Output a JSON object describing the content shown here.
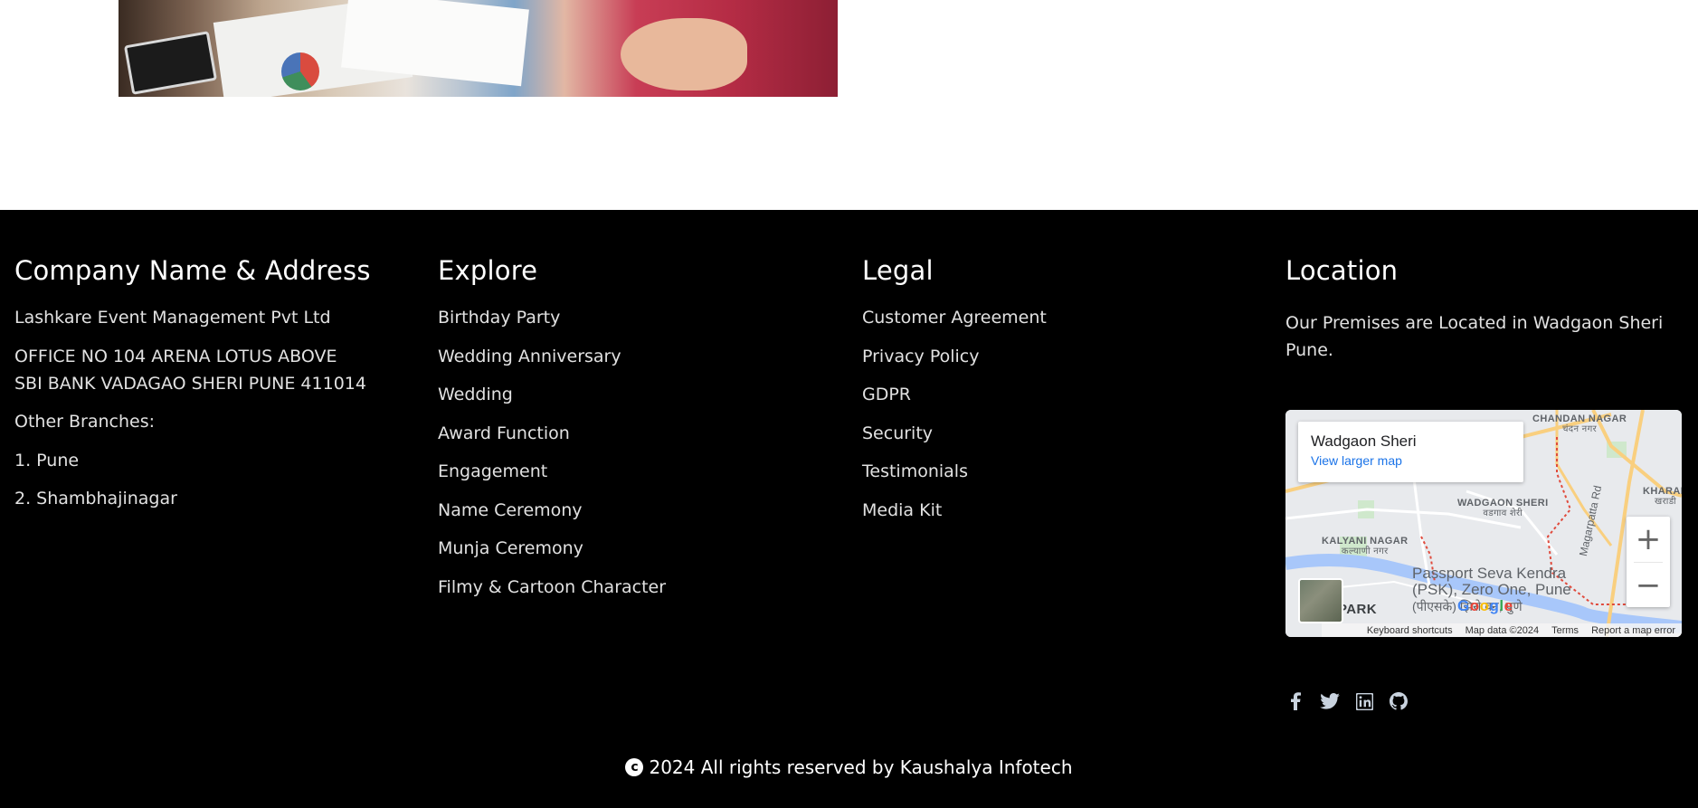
{
  "company": {
    "heading": "Company Name & Address",
    "name": "Lashkare Event Management Pvt Ltd",
    "address_line1": "OFFICE NO 104 ARENA LOTUS ABOVE",
    "address_line2": "SBI BANK VADAGAO SHERI PUNE 411014",
    "branches_label": "Other Branches:",
    "branches": [
      "1. Pune",
      "2. Shambhajinagar"
    ]
  },
  "explore": {
    "heading": "Explore",
    "items": [
      "Birthday Party",
      "Wedding Anniversary",
      "Wedding",
      "Award Function",
      "Engagement",
      "Name Ceremony",
      "Munja Ceremony",
      "Filmy & Cartoon Character"
    ]
  },
  "legal": {
    "heading": "Legal",
    "items": [
      "Customer Agreement",
      "Privacy Policy",
      "GDPR",
      "Security",
      "Testimonials",
      "Media Kit"
    ]
  },
  "location": {
    "heading": "Location",
    "text": "Our Premises are Located in Wadgaon Sheri Pune."
  },
  "map": {
    "place_name": "Wadgaon Sheri",
    "larger_map_link": "View larger map",
    "zoom_in": "+",
    "zoom_out": "−",
    "attribution": [
      "Keyboard shortcuts",
      "Map data ©2024",
      "Terms",
      "Report a map error"
    ],
    "logo": "Google",
    "labels": {
      "chandan_nagar": "CHANDAN NAGAR",
      "chandan_nagar_local": "चंदन नगर",
      "wadgaon_sheri": "WADGAON SHERI",
      "wadgaon_sheri_local": "वडगाव शेरी",
      "kalyani_nagar": "KALYANI NAGAR",
      "kalyani_nagar_local": "कल्याणी नगर",
      "kharadi": "KHARAD",
      "kharadi_local": "खराडी",
      "psk_line1": "Passport Seva Kendra",
      "psk_line2": "(PSK), Zero One, Pune",
      "psk_line3": "(पीएसके) झिरो वन, पुणे",
      "park": "PARK",
      "road": "Magarpatta Rd"
    }
  },
  "social": [
    "facebook-icon",
    "twitter-icon",
    "linkedin-icon",
    "github-icon"
  ],
  "copyright": {
    "symbol": "c",
    "text": "2024 All rights reserved by Kaushalya Infotech"
  }
}
